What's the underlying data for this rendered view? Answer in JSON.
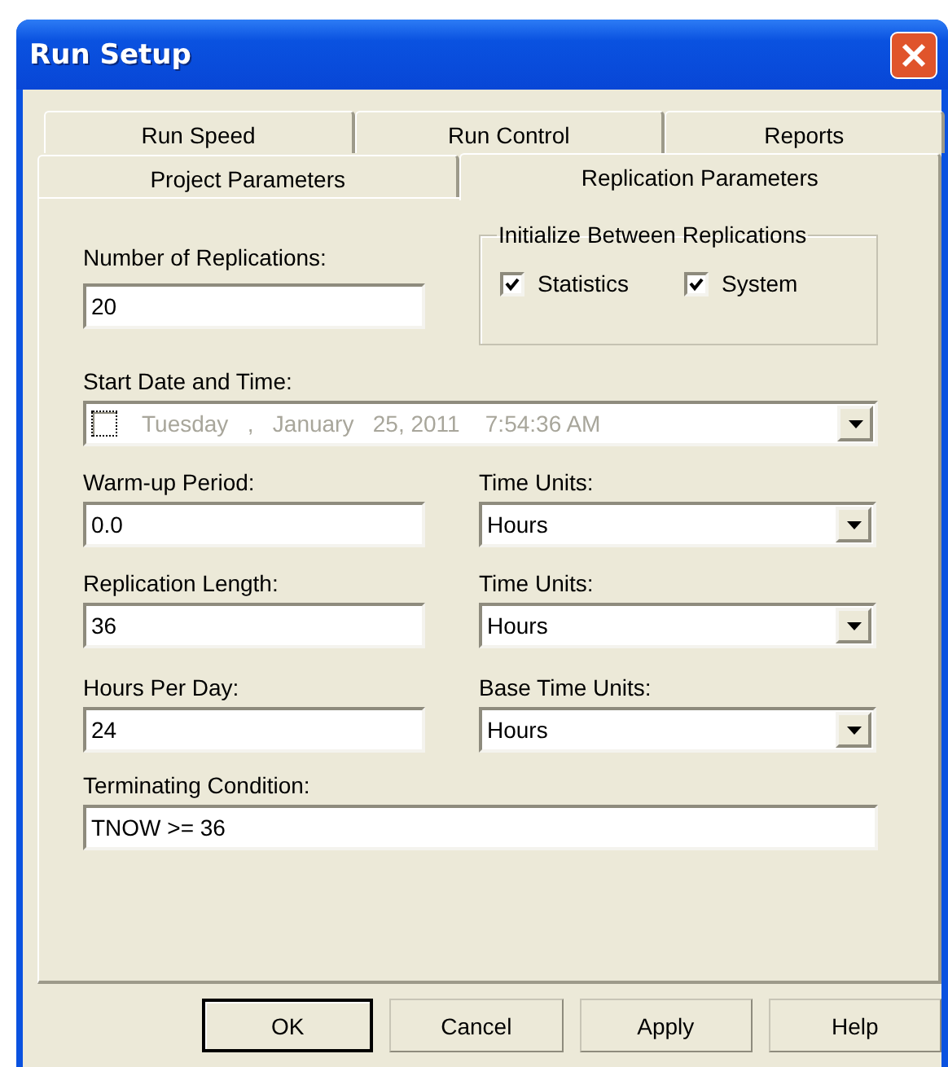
{
  "window": {
    "title": "Run Setup"
  },
  "tabs": [
    [
      {
        "label": "Run Speed",
        "selected": false
      },
      {
        "label": "Run Control",
        "selected": false
      },
      {
        "label": "Reports",
        "selected": false
      }
    ],
    [
      {
        "label": "Project Parameters",
        "selected": false
      },
      {
        "label": "Replication Parameters",
        "selected": true
      }
    ]
  ],
  "replications": {
    "label": "Number of Replications:",
    "value": "20"
  },
  "initialize": {
    "title": "Initialize Between Replications",
    "options": [
      {
        "label": "Statistics",
        "checked": true
      },
      {
        "label": "System",
        "checked": true
      }
    ]
  },
  "start_date": {
    "label": "Start Date and Time:",
    "checked": false,
    "disabled": true,
    "value": "Tuesday   ,   January   25, 2011    7:54:36 AM"
  },
  "rows": [
    {
      "left": {
        "label": "Warm-up Period:",
        "value": "0.0"
      },
      "right": {
        "label": "Time Units:",
        "value": "Hours"
      }
    },
    {
      "left": {
        "label": "Replication Length:",
        "value": "36"
      },
      "right": {
        "label": "Time Units:",
        "value": "Hours"
      }
    },
    {
      "left": {
        "label": "Hours Per Day:",
        "value": "24"
      },
      "right": {
        "label": "Base Time Units:",
        "value": "Hours"
      }
    }
  ],
  "terminating": {
    "label": "Terminating Condition:",
    "value": "TNOW >= 36"
  },
  "buttons": [
    {
      "label": "OK",
      "default": true
    },
    {
      "label": "Cancel",
      "default": false
    },
    {
      "label": "Apply",
      "default": false
    },
    {
      "label": "Help",
      "default": false
    }
  ]
}
